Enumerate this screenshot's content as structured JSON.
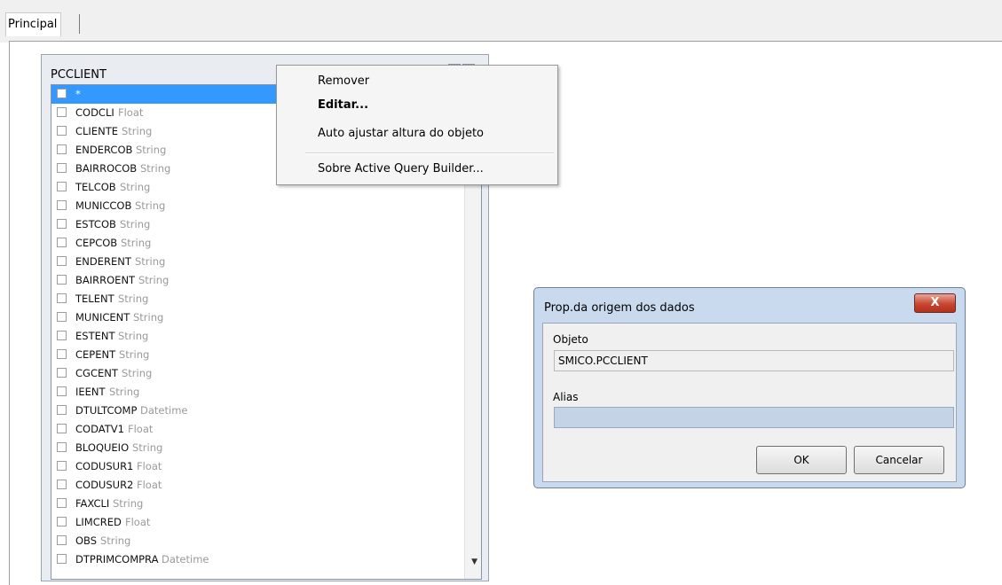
{
  "tabs": [
    {
      "label": "Principal",
      "active": true
    }
  ],
  "table_object": {
    "title": "PCCLIENT",
    "fields": [
      {
        "name": "*",
        "type": "",
        "checked": false,
        "selected": true
      },
      {
        "name": "CODCLI",
        "type": "Float"
      },
      {
        "name": "CLIENTE",
        "type": "String"
      },
      {
        "name": "ENDERCOB",
        "type": "String"
      },
      {
        "name": "BAIRROCOB",
        "type": "String"
      },
      {
        "name": "TELCOB",
        "type": "String"
      },
      {
        "name": "MUNICCOB",
        "type": "String"
      },
      {
        "name": "ESTCOB",
        "type": "String"
      },
      {
        "name": "CEPCOB",
        "type": "String"
      },
      {
        "name": "ENDERENT",
        "type": "String"
      },
      {
        "name": "BAIRROENT",
        "type": "String"
      },
      {
        "name": "TELENT",
        "type": "String"
      },
      {
        "name": "MUNICENT",
        "type": "String"
      },
      {
        "name": "ESTENT",
        "type": "String"
      },
      {
        "name": "CEPENT",
        "type": "String"
      },
      {
        "name": "CGCENT",
        "type": "String"
      },
      {
        "name": "IEENT",
        "type": "String"
      },
      {
        "name": "DTULTCOMP",
        "type": "Datetime"
      },
      {
        "name": "CODATV1",
        "type": "Float"
      },
      {
        "name": "BLOQUEIO",
        "type": "String"
      },
      {
        "name": "CODUSUR1",
        "type": "Float"
      },
      {
        "name": "CODUSUR2",
        "type": "Float"
      },
      {
        "name": "FAXCLI",
        "type": "String"
      },
      {
        "name": "LIMCRED",
        "type": "Float"
      },
      {
        "name": "OBS",
        "type": "String"
      },
      {
        "name": "DTPRIMCOMPRA",
        "type": "Datetime"
      }
    ]
  },
  "context_menu": {
    "items": [
      {
        "label": "Remover",
        "bold": false
      },
      {
        "label": "Editar...",
        "bold": true
      },
      {
        "label": "Auto ajustar altura do objeto",
        "bold": false
      },
      {
        "label": "Sobre Active Query Builder...",
        "bold": false
      }
    ]
  },
  "dialog": {
    "title": "Prop.da origem dos dados",
    "close_label": "X",
    "object_label": "Objeto",
    "object_value": "SMICO.PCCLIENT",
    "alias_label": "Alias",
    "alias_value": "",
    "ok_label": "OK",
    "cancel_label": "Cancelar"
  },
  "colors": {
    "selection": "#3399ff",
    "dialog_frame": "#c9d9ee",
    "close_button": "#c7462f"
  }
}
